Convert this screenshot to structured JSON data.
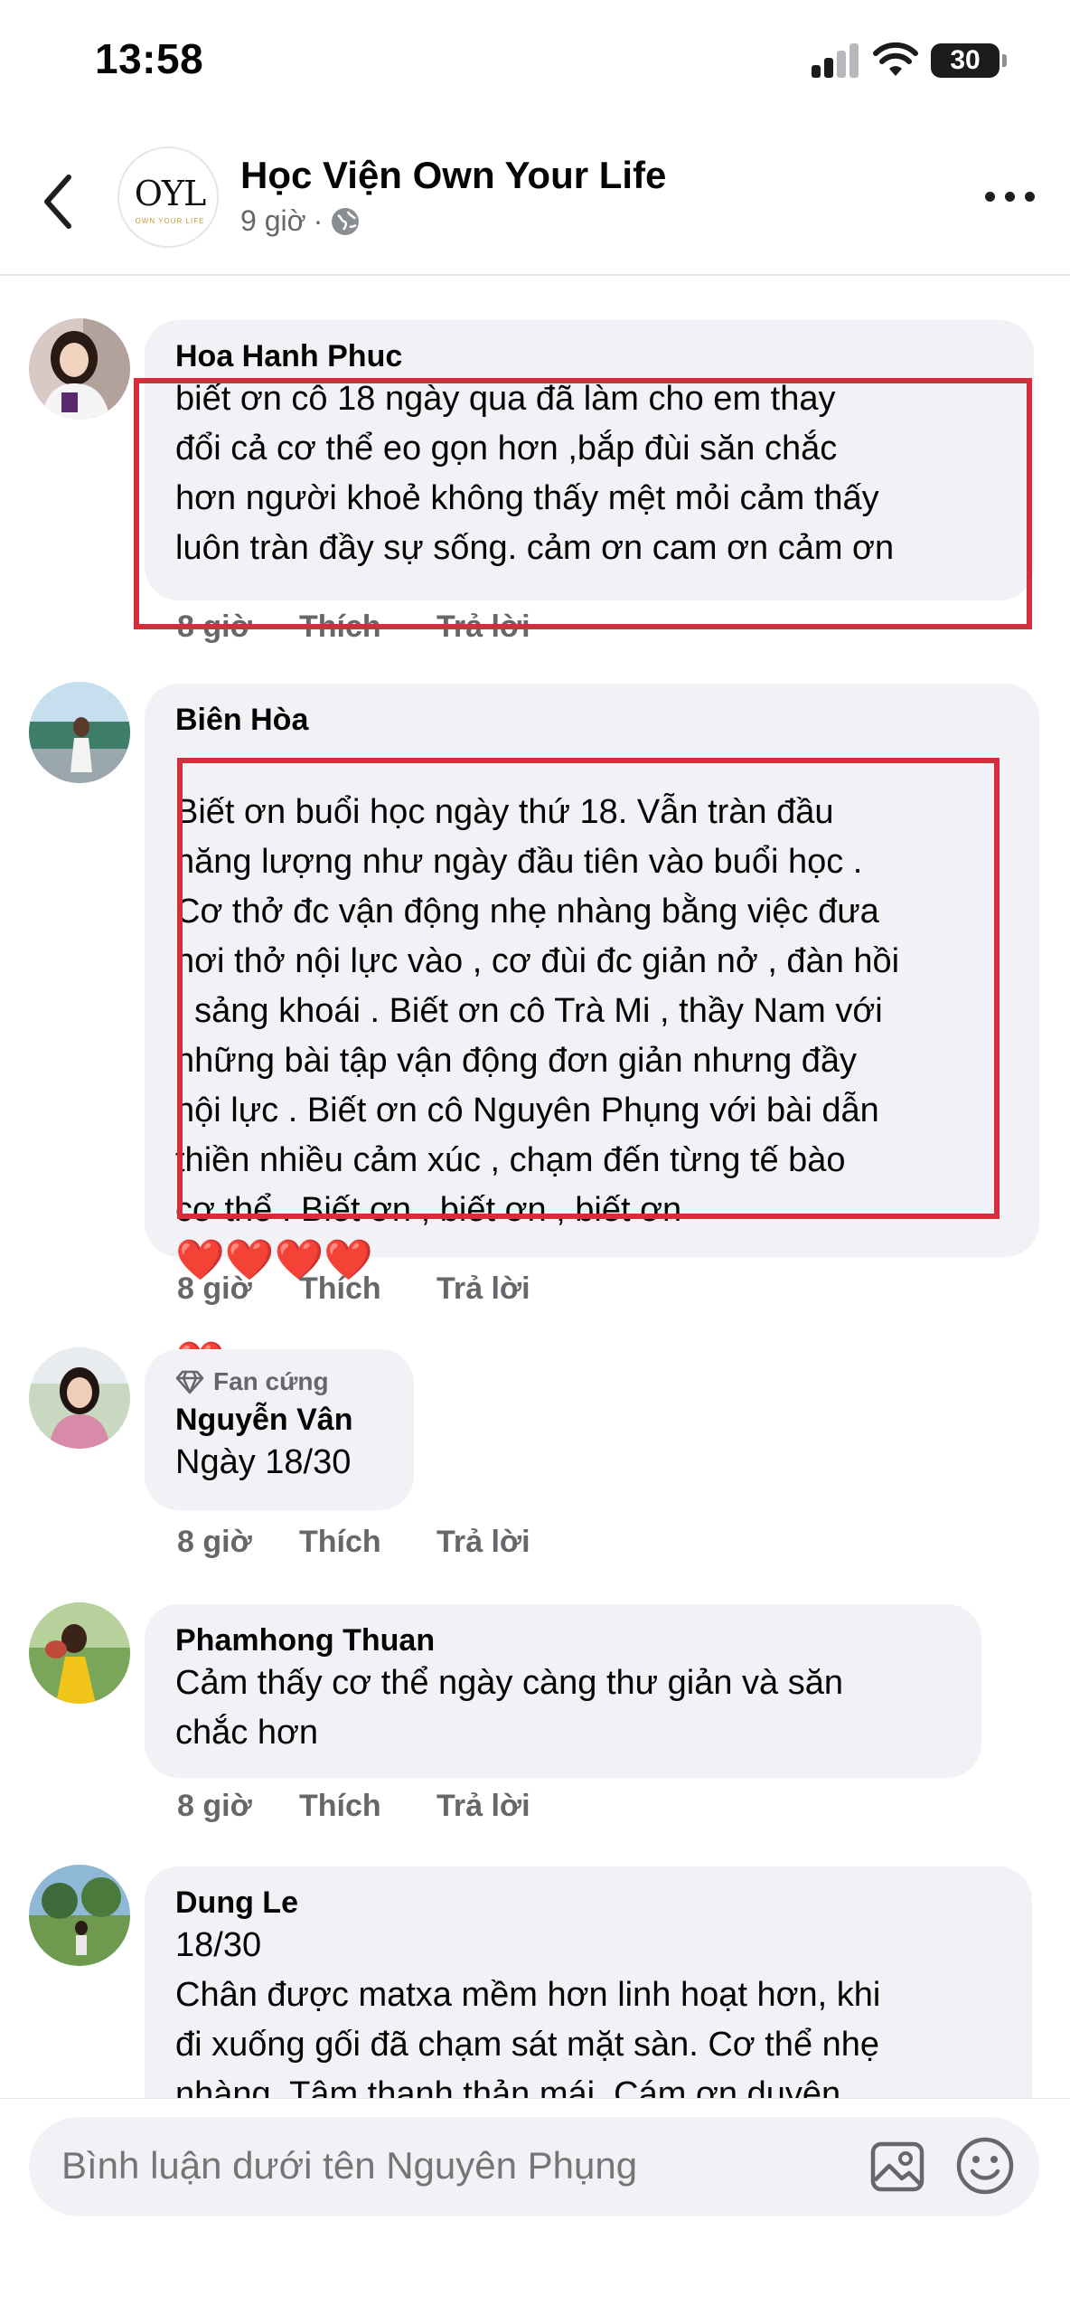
{
  "status_bar": {
    "time": "13:58",
    "battery": "30"
  },
  "header": {
    "page_name": "Học Viện Own Your Life",
    "time_ago": "9 giờ",
    "separator": "·",
    "logo_text": "OYL",
    "logo_subtext": "OWN YOUR LIFE"
  },
  "comments": [
    {
      "author": "Hoa Hanh Phuc",
      "text": "biết ơn cô 18 ngày qua đã làm cho em thay\nđổi cả cơ thể eo gọn hơn ,bắp đùi săn chắc\nhơn người khoẻ không thấy mệt mỏi cảm thấy\nluôn tràn đầy sự sống. cảm ơn cam ơn cảm ơn",
      "time": "8 giờ",
      "like": "Thích",
      "reply": "Trả lời"
    },
    {
      "author": "Biên Hòa",
      "text": "Biết ơn buổi học ngày thứ 18. Vẫn tràn đầu\nnăng lượng như ngày đầu tiên vào buổi học .\nCơ thở đc vận động nhẹ nhàng bằng việc đưa\nhơi thở nội lực vào , cơ đùi đc giản nở , đàn hồi\n, sảng khoái . Biết ơn cô Trà Mi , thầy Nam với\nnhững bài tập vận động đơn giản nhưng đầy\nnội lực . Biết ơn cô Nguyên Phụng với bài dẫn\nthiền nhiều cảm xúc , chạm đến từng tế bào\ncơ thể . Biết ơn , biết ơn , biết ơn",
      "hearts": "❤️❤️❤️❤️",
      "last_heart": "❤️",
      "time": "8 giờ",
      "like": "Thích",
      "reply": "Trả lời"
    },
    {
      "badge": "Fan cứng",
      "author": "Nguyễn Vân",
      "text": "Ngày 18/30",
      "time": "8 giờ",
      "like": "Thích",
      "reply": "Trả lời"
    },
    {
      "author": "Phamhong Thuan",
      "text": "Cảm thấy cơ thể ngày càng thư giản và săn\nchắc hơn",
      "time": "8 giờ",
      "like": "Thích",
      "reply": "Trả lời"
    },
    {
      "author": "Dung Le",
      "text": "18/30\nChân được matxa mềm hơn linh hoạt hơn, khi\nđi xuống gối đã chạm sát mặt sàn. Cơ thể nhẹ\nnhàng. Tâm thanh thản mái. Cám ơn duyên"
    }
  ],
  "composer": {
    "placeholder": "Bình luận dưới tên Nguyên Phụng"
  },
  "colors": {
    "highlight": "#d42d3b",
    "bubble": "#f0f2f5",
    "muted": "#65676b"
  }
}
